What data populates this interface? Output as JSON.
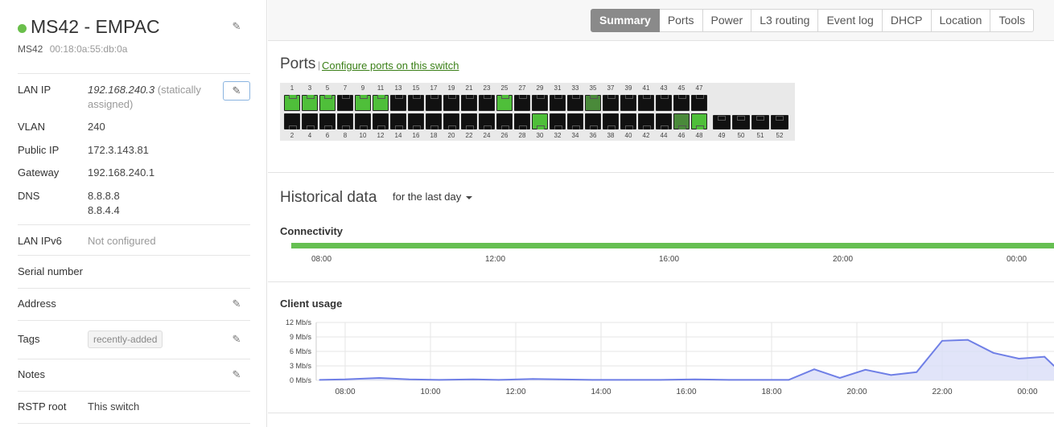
{
  "device": {
    "status_color": "#6abf4b",
    "name": "MS42 - EMPAC",
    "model": "MS42",
    "mac": "00:18:0a:55:db:0a"
  },
  "details": {
    "lan_ip": {
      "label": "LAN IP",
      "value": "192.168.240.3",
      "note_line1": " (statically",
      "note_line2": "assigned)"
    },
    "vlan": {
      "label": "VLAN",
      "value": "240"
    },
    "public_ip": {
      "label": "Public IP",
      "value": "172.3.143.81"
    },
    "gateway": {
      "label": "Gateway",
      "value": "192.168.240.1"
    },
    "dns": {
      "label": "DNS",
      "value1": "8.8.8.8",
      "value2": "8.8.4.4"
    },
    "lan_ipv6": {
      "label": "LAN IPv6",
      "value": "Not configured"
    },
    "serial": {
      "label": "Serial number"
    },
    "address": {
      "label": "Address"
    },
    "tags": {
      "label": "Tags",
      "value": "recently-added"
    },
    "notes": {
      "label": "Notes"
    },
    "rstp": {
      "label": "RSTP root",
      "value": "This switch"
    }
  },
  "tabs": [
    "Summary",
    "Ports",
    "Power",
    "L3 routing",
    "Event log",
    "DHCP",
    "Location",
    "Tools"
  ],
  "active_tab": "Summary",
  "ports": {
    "title": "Ports",
    "separator": "|",
    "configure_link": "Configure ports on this switch",
    "top_numbers": [
      "1",
      "3",
      "5",
      "7",
      "9",
      "11",
      "13",
      "15",
      "17",
      "19",
      "21",
      "23",
      "25",
      "27",
      "29",
      "31",
      "33",
      "35",
      "37",
      "39",
      "41",
      "43",
      "45",
      "47"
    ],
    "bottom_numbers": [
      "2",
      "4",
      "6",
      "8",
      "10",
      "12",
      "14",
      "16",
      "18",
      "20",
      "22",
      "24",
      "26",
      "28",
      "30",
      "32",
      "34",
      "36",
      "38",
      "40",
      "42",
      "44",
      "46",
      "48"
    ],
    "sfp_numbers": [
      "49",
      "50",
      "51",
      "52"
    ],
    "top_status": [
      "up",
      "up",
      "up",
      "down",
      "up",
      "up",
      "down",
      "down",
      "down",
      "down",
      "down",
      "down",
      "up",
      "down",
      "down",
      "down",
      "down",
      "dim",
      "down",
      "down",
      "down",
      "down",
      "down",
      "down"
    ],
    "bottom_status": [
      "down",
      "down",
      "down",
      "down",
      "down",
      "down",
      "down",
      "down",
      "down",
      "down",
      "down",
      "down",
      "down",
      "down",
      "up",
      "down",
      "down",
      "down",
      "down",
      "down",
      "down",
      "down",
      "dim",
      "up"
    ],
    "colors": {
      "up": "#4fbf3a",
      "dim": "#4a8a3a",
      "down": "#111111"
    }
  },
  "historical": {
    "title": "Historical data",
    "range": "for the last day",
    "connectivity": {
      "title": "Connectivity",
      "color": "#66bf52",
      "ticks": [
        "08:00",
        "12:00",
        "16:00",
        "20:00",
        "00:00"
      ]
    }
  },
  "chart_data": {
    "type": "area",
    "title": "Client usage",
    "ylabel": "",
    "xlabel": "",
    "y_tick_labels": [
      "12 Mb/s",
      "9 Mb/s",
      "6 Mb/s",
      "3 Mb/s",
      "0 Mb/s"
    ],
    "y_ticks": [
      12,
      9,
      6,
      3,
      0
    ],
    "ylim": [
      0,
      12
    ],
    "x_tick_labels": [
      "08:00",
      "10:00",
      "12:00",
      "14:00",
      "16:00",
      "18:00",
      "20:00",
      "22:00",
      "00:00"
    ],
    "x_ticks_hours": [
      8,
      10,
      12,
      14,
      16,
      18,
      20,
      22,
      24
    ],
    "x_hours": [
      7.4,
      8,
      8.8,
      9.5,
      10.2,
      11,
      11.6,
      12.4,
      13,
      13.8,
      14.6,
      15.4,
      16.2,
      17,
      17.8,
      18.4,
      19,
      19.6,
      20.2,
      20.8,
      21.4,
      22,
      22.6,
      23.2,
      23.8,
      24.4,
      24.7
    ],
    "values": [
      0.1,
      0.2,
      0.5,
      0.2,
      0.1,
      0.2,
      0.1,
      0.3,
      0.2,
      0.1,
      0.1,
      0.1,
      0.2,
      0.1,
      0.1,
      0.1,
      2.3,
      0.5,
      2.2,
      1.1,
      1.7,
      8.2,
      8.4,
      5.7,
      4.5,
      4.9,
      3.0
    ],
    "line_color": "#6f7fe6",
    "fill_color": "#d9ddf8",
    "grid": true
  }
}
